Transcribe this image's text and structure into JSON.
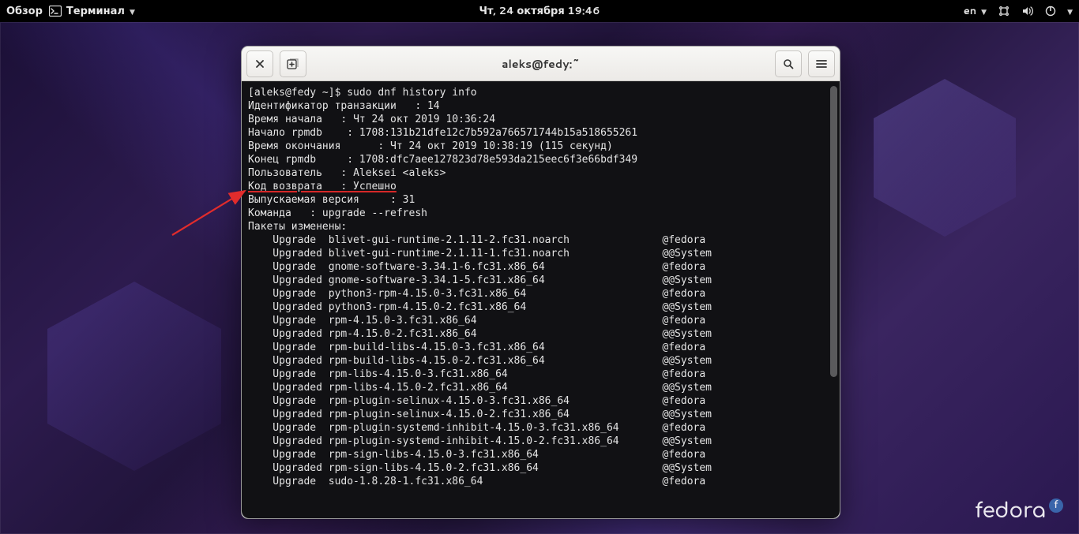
{
  "topbar": {
    "overview": "Обзор",
    "app_name": "Терминал",
    "datetime": "Чт, 24 октября  19:46",
    "lang": "en"
  },
  "window": {
    "title": "aleks@fedy:~"
  },
  "term": {
    "prompt": "[aleks@fedy ~]$ ",
    "command": "sudo dnf history info",
    "fields": {
      "l1a": "Идентификатор транзакции   : ",
      "l1b": "14",
      "l2a": "Время начала   : ",
      "l2b": "Чт 24 окт 2019 10:36:24",
      "l3a": "Начало rpmdb    : ",
      "l3b": "1708:131b21dfe12c7b592a766571744b15a518655261",
      "l4a": "Время окончания      : ",
      "l4b": "Чт 24 окт 2019 10:38:19 (115 секунд)",
      "l5a": "Конец rpmdb     : ",
      "l5b": "1708:dfc7aee127823d78e593da215eec6f3e66bdf349",
      "l6a": "Пользователь   : ",
      "l6b": "Aleksei <aleks>",
      "l7a": "Код возврата   :",
      "l7b": " Успешно",
      "l8": "Выпускаемая версия     : 31",
      "l9": "Команда   : upgrade --refresh",
      "l10": "Пакеты изменены:"
    },
    "packages": [
      {
        "act": "Upgrade ",
        "pkg": "blivet-gui-runtime-2.1.11-2.fc31.noarch",
        "repo": "@fedora"
      },
      {
        "act": "Upgraded",
        "pkg": "blivet-gui-runtime-2.1.11-1.fc31.noarch",
        "repo": "@@System"
      },
      {
        "act": "Upgrade ",
        "pkg": "gnome-software-3.34.1-6.fc31.x86_64",
        "repo": "@fedora"
      },
      {
        "act": "Upgraded",
        "pkg": "gnome-software-3.34.1-5.fc31.x86_64",
        "repo": "@@System"
      },
      {
        "act": "Upgrade ",
        "pkg": "python3-rpm-4.15.0-3.fc31.x86_64",
        "repo": "@fedora"
      },
      {
        "act": "Upgraded",
        "pkg": "python3-rpm-4.15.0-2.fc31.x86_64",
        "repo": "@@System"
      },
      {
        "act": "Upgrade ",
        "pkg": "rpm-4.15.0-3.fc31.x86_64",
        "repo": "@fedora"
      },
      {
        "act": "Upgraded",
        "pkg": "rpm-4.15.0-2.fc31.x86_64",
        "repo": "@@System"
      },
      {
        "act": "Upgrade ",
        "pkg": "rpm-build-libs-4.15.0-3.fc31.x86_64",
        "repo": "@fedora"
      },
      {
        "act": "Upgraded",
        "pkg": "rpm-build-libs-4.15.0-2.fc31.x86_64",
        "repo": "@@System"
      },
      {
        "act": "Upgrade ",
        "pkg": "rpm-libs-4.15.0-3.fc31.x86_64",
        "repo": "@fedora"
      },
      {
        "act": "Upgraded",
        "pkg": "rpm-libs-4.15.0-2.fc31.x86_64",
        "repo": "@@System"
      },
      {
        "act": "Upgrade ",
        "pkg": "rpm-plugin-selinux-4.15.0-3.fc31.x86_64",
        "repo": "@fedora"
      },
      {
        "act": "Upgraded",
        "pkg": "rpm-plugin-selinux-4.15.0-2.fc31.x86_64",
        "repo": "@@System"
      },
      {
        "act": "Upgrade ",
        "pkg": "rpm-plugin-systemd-inhibit-4.15.0-3.fc31.x86_64",
        "repo": "@fedora"
      },
      {
        "act": "Upgraded",
        "pkg": "rpm-plugin-systemd-inhibit-4.15.0-2.fc31.x86_64",
        "repo": "@@System"
      },
      {
        "act": "Upgrade ",
        "pkg": "rpm-sign-libs-4.15.0-3.fc31.x86_64",
        "repo": "@fedora"
      },
      {
        "act": "Upgraded",
        "pkg": "rpm-sign-libs-4.15.0-2.fc31.x86_64",
        "repo": "@@System"
      },
      {
        "act": "Upgrade ",
        "pkg": "sudo-1.8.28-1.fc31.x86_64",
        "repo": "@fedora"
      }
    ]
  },
  "watermark": {
    "text": "fedora",
    "f": "f"
  }
}
